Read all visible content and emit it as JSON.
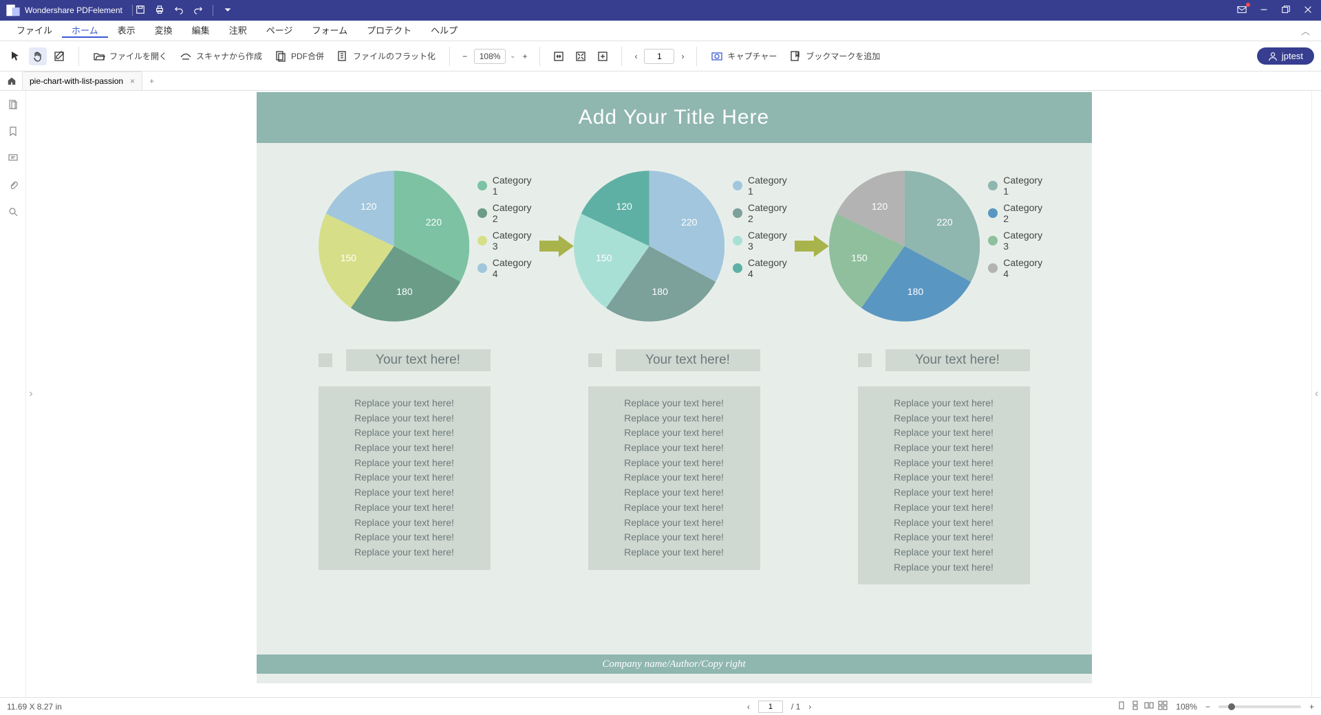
{
  "titleBar": {
    "appName": "Wondershare PDFelement"
  },
  "menu": {
    "items": [
      "ファイル",
      "ホーム",
      "表示",
      "変換",
      "編集",
      "注釈",
      "ページ",
      "フォーム",
      "プロテクト",
      "ヘルプ"
    ],
    "activeIndex": 1
  },
  "toolbar": {
    "openFile": "ファイルを開く",
    "fromScanner": "スキャナから作成",
    "pdfMerge": "PDF合併",
    "flatten": "ファイルのフラット化",
    "zoom": "108%",
    "pageCurrent": "1",
    "capture": "キャプチャー",
    "addBookmark": "ブックマークを追加",
    "user": "jptest"
  },
  "tabs": {
    "docName": "pie-chart-with-list-passion"
  },
  "document": {
    "title": "Add Your Title Here",
    "legendLabels": [
      "Category 1",
      "Category 2",
      "Category 3",
      "Category 4"
    ],
    "textHead": "Your text here!",
    "textLine": "Replace your text here!",
    "footer": "Company name/Author/Copy right"
  },
  "chart_data": [
    {
      "type": "pie",
      "title": "",
      "series": [
        {
          "name": "Category 1",
          "value": 220,
          "color": "#7cc2a3"
        },
        {
          "name": "Category 2",
          "value": 180,
          "color": "#6a9c88"
        },
        {
          "name": "Category 3",
          "value": 150,
          "color": "#d6df88"
        },
        {
          "name": "Category 4",
          "value": 120,
          "color": "#a2c6dd"
        }
      ]
    },
    {
      "type": "pie",
      "title": "",
      "series": [
        {
          "name": "Category 1",
          "value": 220,
          "color": "#a2c6dd"
        },
        {
          "name": "Category 2",
          "value": 180,
          "color": "#7ca09a"
        },
        {
          "name": "Category 3",
          "value": 150,
          "color": "#a9e0d5"
        },
        {
          "name": "Category 4",
          "value": 120,
          "color": "#5fb0a4"
        }
      ]
    },
    {
      "type": "pie",
      "title": "",
      "series": [
        {
          "name": "Category 1",
          "value": 220,
          "color": "#8fb6af"
        },
        {
          "name": "Category 2",
          "value": 180,
          "color": "#5a96c2"
        },
        {
          "name": "Category 3",
          "value": 150,
          "color": "#8fbf9d"
        },
        {
          "name": "Category 4",
          "value": 120,
          "color": "#b3b3b3"
        }
      ]
    }
  ],
  "status": {
    "dimensions": "11.69 X 8.27 in",
    "pageCurrent": "1",
    "pageTotal": "/ 1",
    "zoom": "108%"
  }
}
